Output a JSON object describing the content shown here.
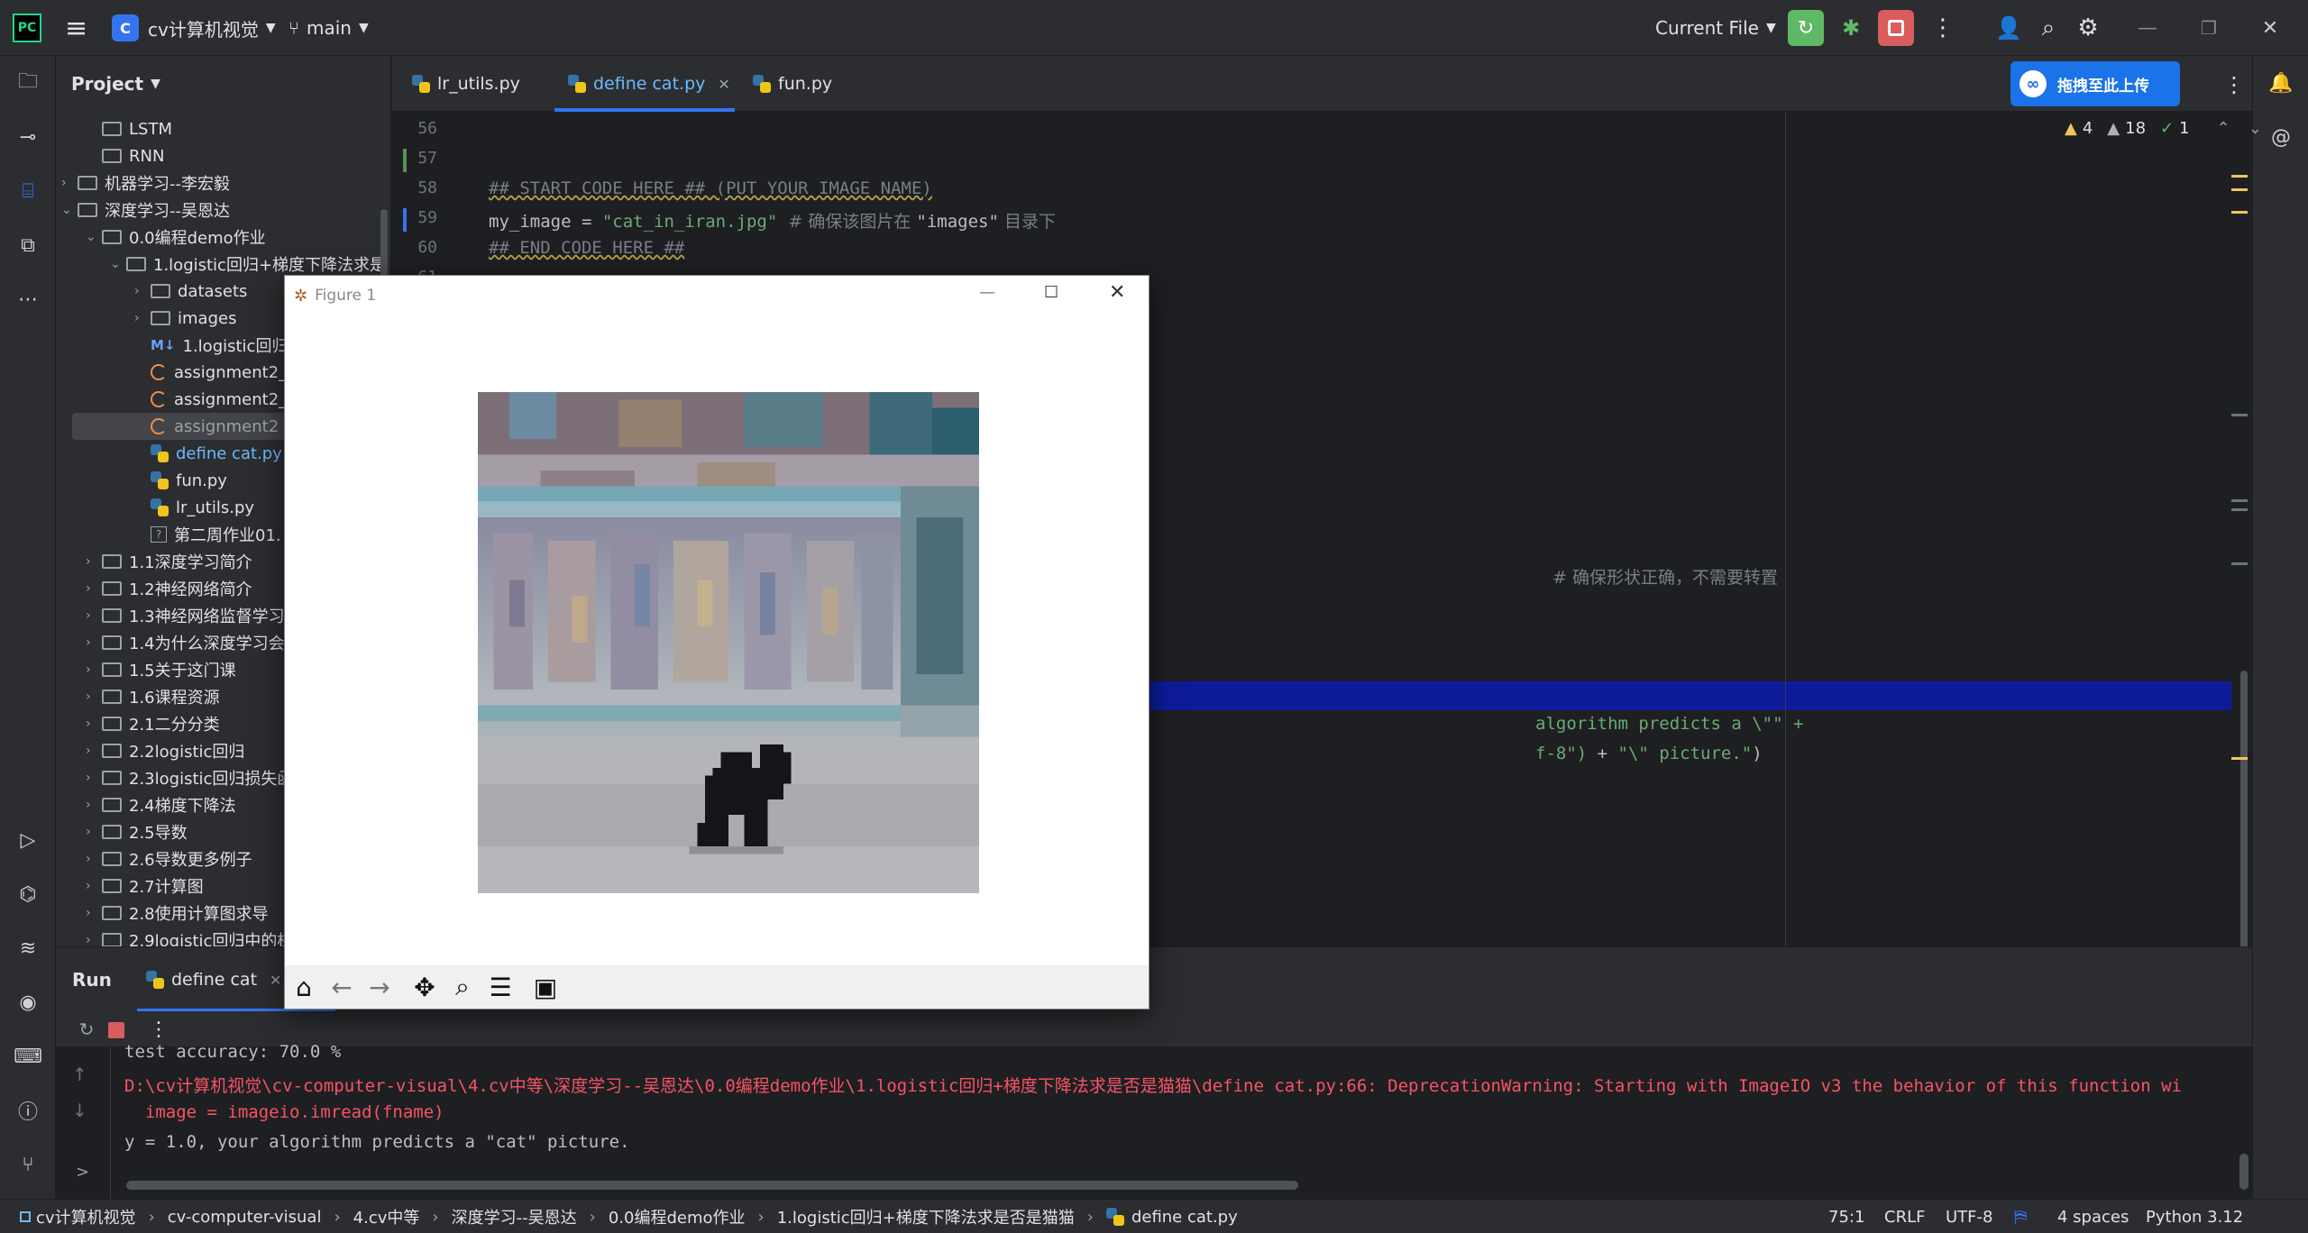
{
  "titlebar": {
    "project_badge": "C",
    "project_name": "cv计算机视觉",
    "branch": "main",
    "run_config": "Current File"
  },
  "project_panel": {
    "title": "Project",
    "tree": [
      {
        "label": "LSTM",
        "kind": "folder"
      },
      {
        "label": "RNN",
        "kind": "folder"
      },
      {
        "label": "机器学习--李宏毅",
        "kind": "folder"
      },
      {
        "label": "深度学习--吴恩达",
        "kind": "folder"
      },
      {
        "label": "0.0编程demo作业",
        "kind": "folder"
      },
      {
        "label": "1.logistic回归+梯度下降法求是",
        "kind": "folder"
      },
      {
        "label": "datasets",
        "kind": "folder"
      },
      {
        "label": "images",
        "kind": "folder"
      },
      {
        "label": "1.logistic回归-",
        "kind": "md"
      },
      {
        "label": "assignment2_",
        "kind": "notebook"
      },
      {
        "label": "assignment2_",
        "kind": "notebook"
      },
      {
        "label": "assignment2",
        "kind": "notebook"
      },
      {
        "label": "define cat.py",
        "kind": "py"
      },
      {
        "label": "fun.py",
        "kind": "py"
      },
      {
        "label": "lr_utils.py",
        "kind": "py"
      },
      {
        "label": "第二周作业01.",
        "kind": "other"
      },
      {
        "label": "1.1深度学习简介",
        "kind": "folder"
      },
      {
        "label": "1.2神经网络简介",
        "kind": "folder"
      },
      {
        "label": "1.3神经网络监督学习",
        "kind": "folder"
      },
      {
        "label": "1.4为什么深度学习会",
        "kind": "folder"
      },
      {
        "label": "1.5关于这门课",
        "kind": "folder"
      },
      {
        "label": "1.6课程资源",
        "kind": "folder"
      },
      {
        "label": "2.1二分分类",
        "kind": "folder"
      },
      {
        "label": "2.2logistic回归",
        "kind": "folder"
      },
      {
        "label": "2.3logistic回归损失函",
        "kind": "folder"
      },
      {
        "label": "2.4梯度下降法",
        "kind": "folder"
      },
      {
        "label": "2.5导数",
        "kind": "folder"
      },
      {
        "label": "2.6导数更多例子",
        "kind": "folder"
      },
      {
        "label": "2.7计算图",
        "kind": "folder"
      },
      {
        "label": "2.8使用计算图求导",
        "kind": "folder"
      },
      {
        "label": "2.9logistic回归中的梯",
        "kind": "folder"
      }
    ]
  },
  "tabs": [
    {
      "label": "lr_utils.py"
    },
    {
      "label": "define cat.py"
    },
    {
      "label": "fun.py"
    }
  ],
  "upload_button": "拖拽至此上传",
  "inspections": {
    "warnings": "4",
    "weak_warnings": "18",
    "ok": "1"
  },
  "editor": {
    "lines": [
      {
        "num": "56"
      },
      {
        "num": "57"
      },
      {
        "num": "58",
        "text": "## START CODE HERE ## (PUT YOUR IMAGE NAME)"
      },
      {
        "num": "59",
        "var": "my_image = ",
        "str": "\"cat_in_iran.jpg\"",
        "comment": "  # 确保该图片在 ",
        "comment_str": "\"images\"",
        "comment_tail": " 目录下"
      },
      {
        "num": "60",
        "text": "## END CODE HERE ##"
      },
      {
        "num": "61"
      }
    ],
    "visible_fragments": {
      "reshape_comment": "# 确保形状正确，不需要转置",
      "predict_line_1": "algorithm predicts a \\\"\" +",
      "predict_line_2_str": "f-8\")",
      "predict_line_2_tail": " + ",
      "predict_line_2_str2": "\"\\\" picture.\"",
      "predict_line_2_end": ")"
    }
  },
  "figure": {
    "title": "Figure 1",
    "image_alt": "pixelated cat in front of tiled wall"
  },
  "run_panel": {
    "title": "Run",
    "tab": "define cat",
    "output": [
      {
        "text": "test accuracy: 70.0 %",
        "color": "#bcbec4"
      },
      {
        "text": "D:\\cv计算机视觉\\cv-computer-visual\\4.cv中等\\深度学习--吴恩达\\0.0编程demo作业\\1.logistic回归+梯度下降法求是否是猫猫\\define cat.py:66: DeprecationWarning: Starting with ImageIO v3 the behavior of this function wi",
        "color": "#f75464"
      },
      {
        "text": "  image = imageio.imread(fname)",
        "color": "#f75464"
      },
      {
        "text": "y = 1.0, your algorithm predicts a \"cat\" picture.",
        "color": "#bcbec4"
      }
    ]
  },
  "statusbar": {
    "breadcrumbs": [
      "cv计算机视觉",
      "cv-computer-visual",
      "4.cv中等",
      "深度学习--吴恩达",
      "0.0编程demo作业",
      "1.logistic回归+梯度下降法求是否是猫猫",
      "define cat.py"
    ],
    "position": "75:1",
    "line_sep": "CRLF",
    "encoding": "UTF-8",
    "indent": "4 spaces",
    "interpreter": "Python 3.12"
  }
}
